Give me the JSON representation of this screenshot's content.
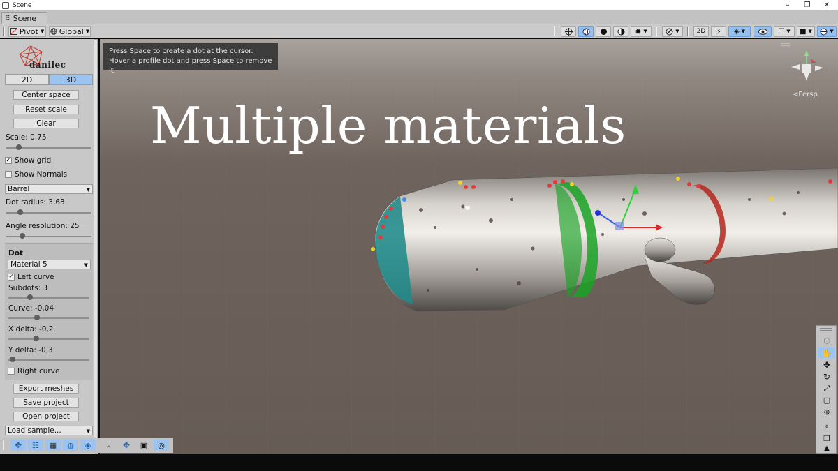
{
  "window": {
    "title": "Scene",
    "controls": {
      "minimize": "–",
      "restore": "❐",
      "close": "✕"
    }
  },
  "tab": {
    "label": "Scene"
  },
  "toolbar": {
    "pivot_label": "Pivot",
    "global_label": "Global"
  },
  "panel": {
    "logo_text": "danilec",
    "mode_2d": "2D",
    "mode_3d": "3D",
    "active_mode": "3D",
    "center_space": "Center space",
    "reset_scale": "Reset scale",
    "clear": "Clear",
    "scale_label": "Scale: 0,75",
    "scale_fraction": 0.12,
    "show_grid": {
      "label": "Show grid",
      "checked": true
    },
    "show_normals": {
      "label": "Show Normals",
      "checked": false
    },
    "shape_select": "Barrel",
    "dot_radius_label": "Dot radius: 3,63",
    "dot_radius_fraction": 0.14,
    "angle_resolution_label": "Angle resolution: 25",
    "angle_resolution_fraction": 0.17,
    "dot_section": {
      "header": "Dot",
      "material_select": "Material 5",
      "left_curve": {
        "label": "Left curve",
        "checked": true
      },
      "subdots_label": "Subdots: 3",
      "subdots_fraction": 0.25,
      "curve_label": "Curve: -0,04",
      "curve_fraction": 0.34,
      "x_delta_label": "X delta: -0,2",
      "x_delta_fraction": 0.33,
      "y_delta_label": "Y delta: -0,3",
      "y_delta_fraction": 0.02,
      "right_curve": {
        "label": "Right curve",
        "checked": false
      }
    },
    "export_meshes": "Export meshes",
    "save_project": "Save project",
    "open_project": "Open project",
    "load_sample": "Load sample..."
  },
  "viewport": {
    "hint_line1": "Press Space to create a dot at the cursor.",
    "hint_line2": "Hover a profile dot and press Space to remove it.",
    "title": "Multiple materials",
    "projection": "<Persp"
  },
  "colors": {
    "accent": "#96c0ee",
    "material_teal": "#1f8a8a",
    "material_green": "#19a324",
    "material_red": "#b5261d",
    "dot_red": "#e23b3b",
    "dot_yellow": "#f2d22e",
    "dot_blue": "#3a8df0"
  }
}
